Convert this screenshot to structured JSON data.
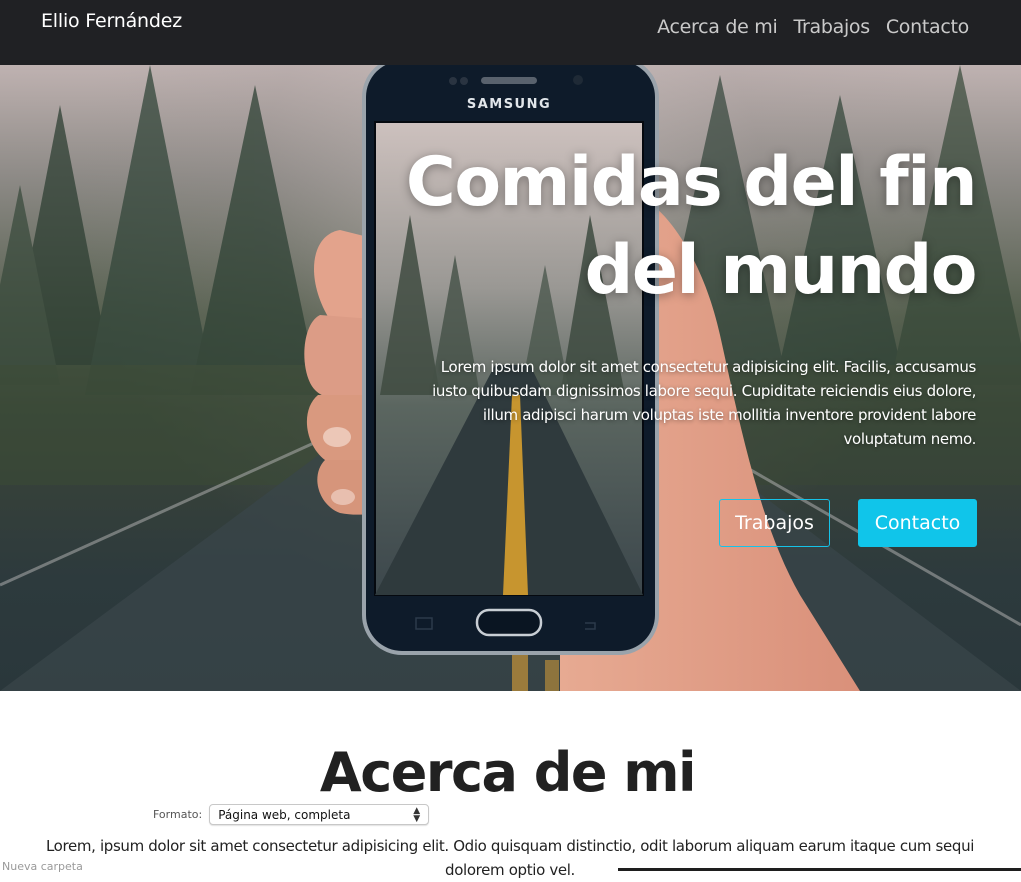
{
  "navbar": {
    "brand": "Ellio Fernández",
    "links": [
      "Acerca de mi",
      "Trabajos",
      "Contacto"
    ]
  },
  "hero": {
    "title": "Comidas del fin del mundo",
    "text": "Lorem ipsum dolor sit amet consectetur adipisicing elit. Facilis, accusamus iusto quibusdam dignissimos labore sequi. Cupiditate reiciendis eius dolore, illum adipisci harum voluptas iste mollitia inventore provident labore voluptatum nemo.",
    "phone_brand": "SAMSUNG",
    "buttons": {
      "secondary": "Trabajos",
      "primary": "Contacto"
    }
  },
  "about": {
    "title": "Acerca de mi",
    "text": "Lorem, ipsum dolor sit amet consectetur adipisicing elit. Odio quisquam distinctio, odit laborum aliquam earum itaque cum sequi dolorem optio vel."
  },
  "save_dialog": {
    "format_label": "Formato:",
    "format_value": "Página web, completa",
    "bottom_text": "Nueva carpeta"
  },
  "colors": {
    "navbar_bg": "#202124",
    "accent": "#10c5ea",
    "text_dark": "#212121"
  }
}
